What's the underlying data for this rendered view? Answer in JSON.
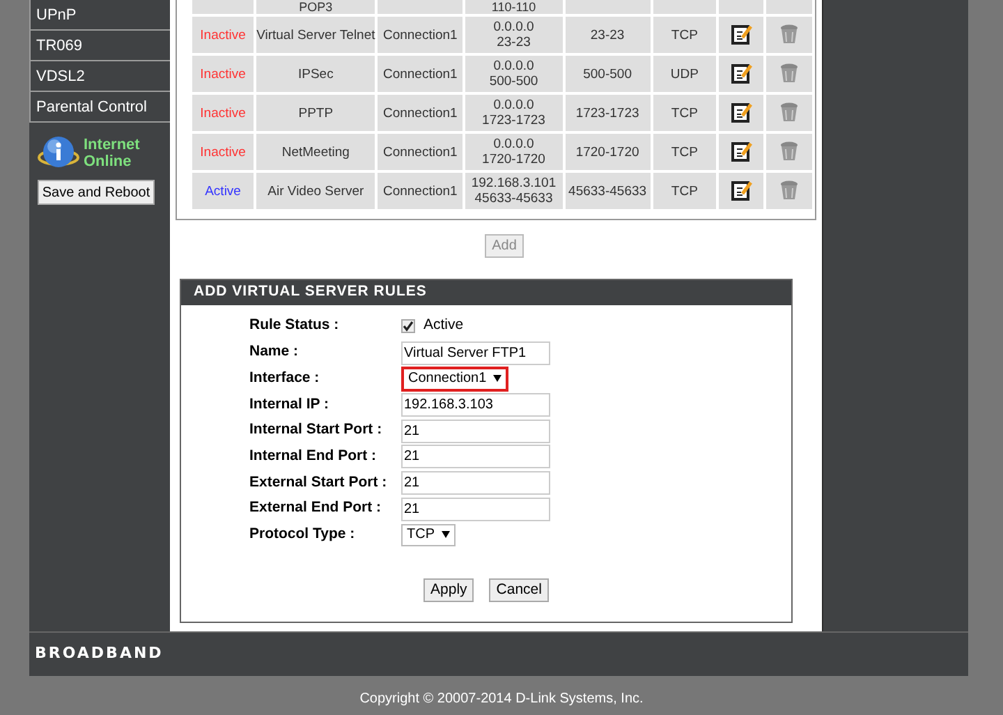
{
  "sidebar": {
    "items": [
      {
        "label": "UPnP"
      },
      {
        "label": "TR069"
      },
      {
        "label": "VDSL2"
      },
      {
        "label": "Parental Control"
      }
    ],
    "status": {
      "line_1": "Internet",
      "line_2": "Online"
    },
    "save_button": "Save and Reboot"
  },
  "rules_table": {
    "partial_row": {
      "name": "POP3",
      "ip": "110-110"
    },
    "rows": [
      {
        "status": "Inactive",
        "active": false,
        "name": "Virtual Server Telnet",
        "interface": "Connection1",
        "ip": [
          "0.0.0.0",
          "23-23"
        ],
        "port": "23-23",
        "protocol": "TCP"
      },
      {
        "status": "Inactive",
        "active": false,
        "name": "IPSec",
        "interface": "Connection1",
        "ip": [
          "0.0.0.0",
          "500-500"
        ],
        "port": "500-500",
        "protocol": "UDP"
      },
      {
        "status": "Inactive",
        "active": false,
        "name": "PPTP",
        "interface": "Connection1",
        "ip": [
          "0.0.0.0",
          "1723-1723"
        ],
        "port": "1723-1723",
        "protocol": "TCP"
      },
      {
        "status": "Inactive",
        "active": false,
        "name": "NetMeeting",
        "interface": "Connection1",
        "ip": [
          "0.0.0.0",
          "1720-1720"
        ],
        "port": "1720-1720",
        "protocol": "TCP"
      },
      {
        "status": "Active",
        "active": true,
        "name": "Air Video Server",
        "interface": "Connection1",
        "ip": [
          "192.168.3.101",
          "45633-45633"
        ],
        "port": "45633-45633",
        "protocol": "TCP"
      }
    ],
    "add_button": "Add"
  },
  "add_rules": {
    "title": "ADD VIRTUAL SERVER RULES",
    "fields": [
      {
        "kind": "checkbox",
        "label": "Rule Status :",
        "checked": true,
        "text": "Active"
      },
      {
        "kind": "text",
        "label": "Name :",
        "value": "Virtual Server FTP1"
      },
      {
        "kind": "select",
        "label": "Interface :",
        "value": "Connection1",
        "highlighted": true
      },
      {
        "kind": "text",
        "label": "Internal IP :",
        "value": "192.168.3.103"
      },
      {
        "kind": "text",
        "label": "Internal Start Port :",
        "value": "21"
      },
      {
        "kind": "text",
        "label": "Internal End Port :",
        "value": "21"
      },
      {
        "kind": "text",
        "label": "External Start Port :",
        "value": "21"
      },
      {
        "kind": "text",
        "label": "External End Port :",
        "value": "21"
      },
      {
        "kind": "select",
        "label": "Protocol Type :",
        "value": "TCP",
        "highlighted": false
      }
    ],
    "buttons": [
      "Apply",
      "Cancel"
    ]
  },
  "footer": {
    "brand": "BROADBAND",
    "copyright": "Copyright © 20007-2014 D-Link Systems, Inc."
  }
}
